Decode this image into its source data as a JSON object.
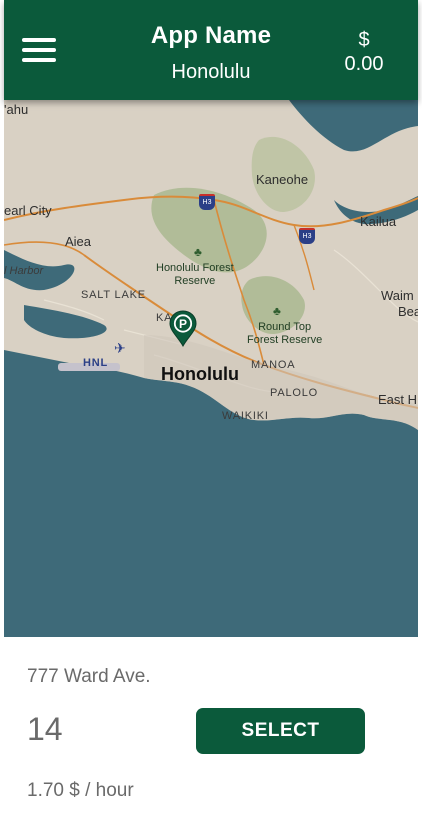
{
  "header": {
    "app_name": "App Name",
    "city": "Honolulu",
    "balance_currency": "$",
    "balance_value": "0.00",
    "menu_icon": "hamburger-menu-icon"
  },
  "map": {
    "labels": {
      "ahu": "'ahu",
      "pearl_city": "earl City",
      "aiea": "Aiea",
      "harbor": "l Harbor",
      "salt_lake": "SALT LAKE",
      "kaneohe": "Kaneohe",
      "kailua": "Kailua",
      "honolulu_forest": "Honolulu Forest",
      "reserve": "Reserve",
      "round_top": "Round Top",
      "forest_reserve": "Forest Reserve",
      "honolulu": "Honolulu",
      "manoa": "MANOA",
      "palolo": "PALOLO",
      "waikiki": "WAIKIKI",
      "hnl": "HNL",
      "waim": "Waim",
      "bea": "Bea",
      "east_h": "East H",
      "ka": "KA",
      "h3_a": "H3",
      "h3_b": "H3",
      "i_shield": "I"
    },
    "pin_icon": "parking-pin-icon"
  },
  "spot": {
    "address": "777 Ward Ave.",
    "number": "14",
    "select_label": "SELECT",
    "rate": "1.70 $ / hour"
  },
  "colors": {
    "brand_green": "#0b5a3b",
    "water": "#3e6a79",
    "land": "#d9d1c4"
  }
}
